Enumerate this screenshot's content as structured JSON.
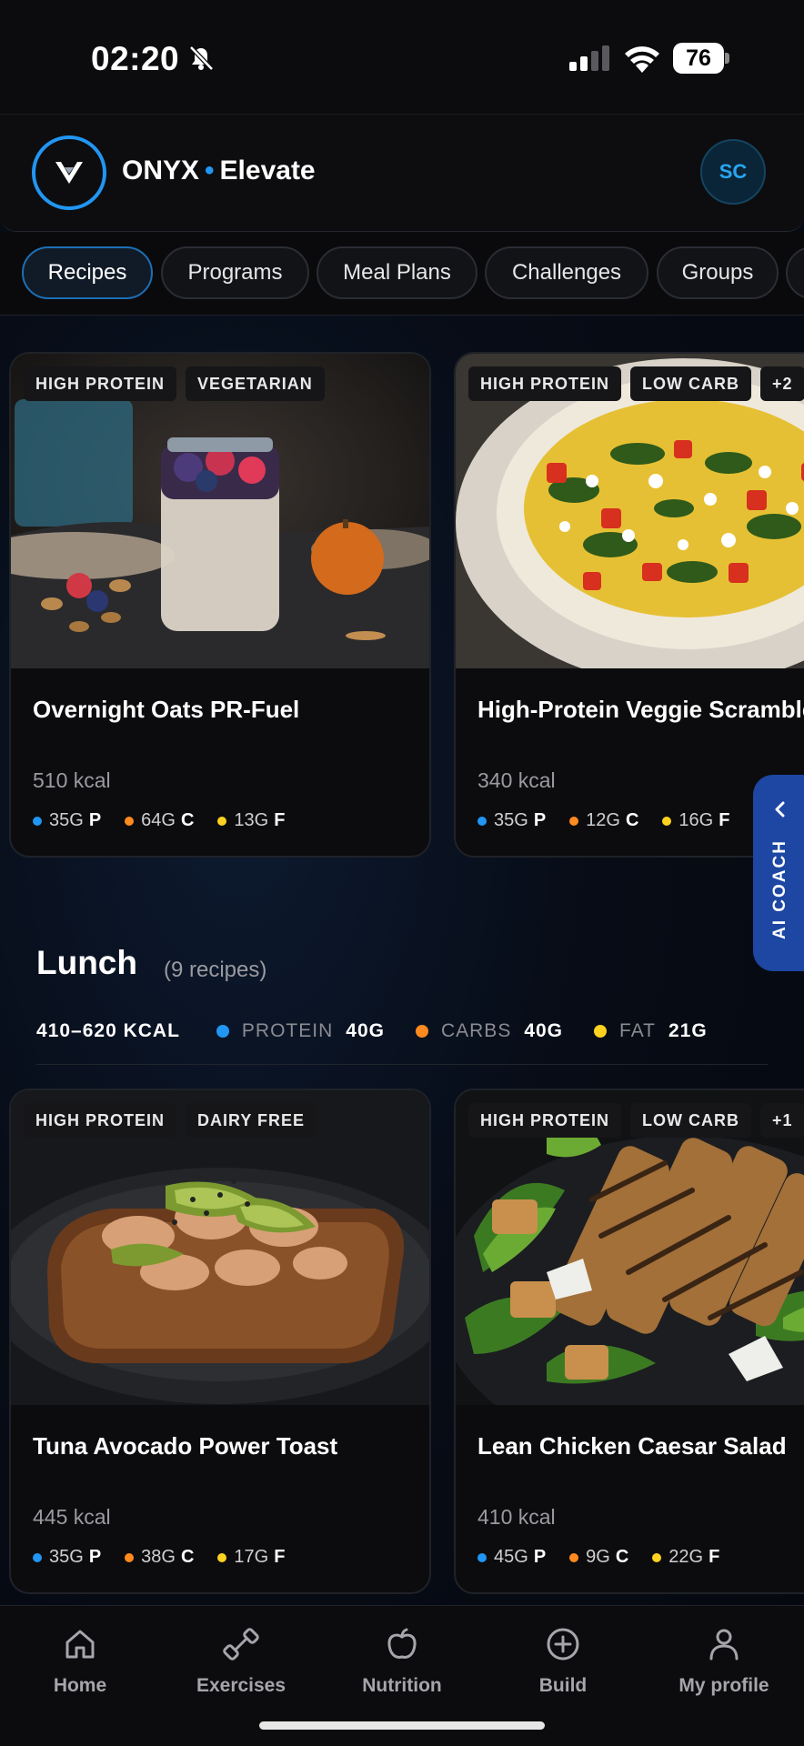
{
  "status_bar": {
    "time": "02:20",
    "battery": "76"
  },
  "header": {
    "brand": "ONYX",
    "brand_separator": "•",
    "brand_suffix": "Elevate",
    "avatar_initials": "SC"
  },
  "tabs": [
    "Recipes",
    "Programs",
    "Meal Plans",
    "Challenges",
    "Groups"
  ],
  "active_tab": "Recipes",
  "breakfast_cards": [
    {
      "tags": [
        "HIGH PROTEIN",
        "VEGETARIAN"
      ],
      "title": "Overnight Oats PR-Fuel",
      "kcal": "510 kcal",
      "macros": {
        "protein": "35G",
        "carbs": "64G",
        "fat": "13G"
      }
    },
    {
      "tags": [
        "HIGH PROTEIN",
        "LOW CARB",
        "+2"
      ],
      "title": "High-Protein Veggie Scramble",
      "kcal": "340 kcal",
      "macros": {
        "protein": "35G",
        "carbs": "12G",
        "fat": "16G"
      }
    }
  ],
  "lunch": {
    "title": "Lunch",
    "count": "(9 recipes)",
    "kcal_range": "410–620 KCAL",
    "targets": [
      {
        "label": "PROTEIN",
        "value": "40G",
        "color": "#2196f3"
      },
      {
        "label": "CARBS",
        "value": "40G",
        "color": "#ff8a1f"
      },
      {
        "label": "FAT",
        "value": "21G",
        "color": "#ffd21f"
      }
    ],
    "cards": [
      {
        "tags": [
          "HIGH PROTEIN",
          "DAIRY FREE"
        ],
        "title": "Tuna Avocado Power Toast",
        "kcal": "445 kcal",
        "macros": {
          "protein": "35G",
          "carbs": "38G",
          "fat": "17G"
        }
      },
      {
        "tags": [
          "HIGH PROTEIN",
          "LOW CARB",
          "+1"
        ],
        "title": "Lean Chicken Caesar Salad",
        "kcal": "410 kcal",
        "macros": {
          "protein": "45G",
          "carbs": "9G",
          "fat": "22G"
        }
      }
    ]
  },
  "macro_letters": {
    "protein": "P",
    "carbs": "C",
    "fat": "F"
  },
  "macro_colors": {
    "protein": "#2196f3",
    "carbs": "#ff8a1f",
    "fat": "#ffd21f",
    "accent": "#2196f3"
  },
  "ai_coach": {
    "label": "AI COACH"
  },
  "bottom_nav": [
    {
      "label": "Home",
      "icon": "home-icon"
    },
    {
      "label": "Exercises",
      "icon": "dumbbell-icon"
    },
    {
      "label": "Nutrition",
      "icon": "apple-icon"
    },
    {
      "label": "Build",
      "icon": "plus-circle-icon"
    },
    {
      "label": "My profile",
      "icon": "user-icon"
    }
  ]
}
